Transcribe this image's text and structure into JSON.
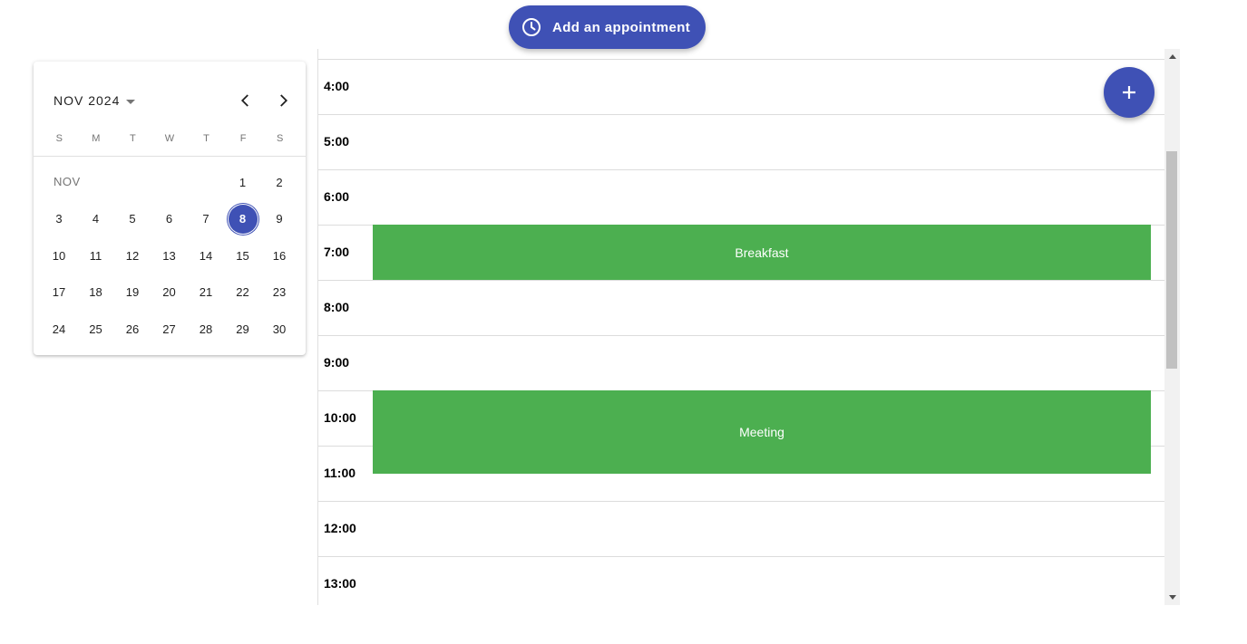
{
  "header": {
    "add_button_label": "Add an appointment",
    "add_button_icon": "clock-icon",
    "accent_color": "#3f51b5"
  },
  "datepicker": {
    "month_year": "NOV 2024",
    "month_short": "NOV",
    "weekdays": [
      "S",
      "M",
      "T",
      "W",
      "T",
      "F",
      "S"
    ],
    "days": [
      "1",
      "2",
      "3",
      "4",
      "5",
      "6",
      "7",
      "8",
      "9",
      "10",
      "11",
      "12",
      "13",
      "14",
      "15",
      "16",
      "17",
      "18",
      "19",
      "20",
      "21",
      "22",
      "23",
      "24",
      "25",
      "26",
      "27",
      "28",
      "29",
      "30"
    ],
    "first_weekday": 5,
    "selected_day": "8"
  },
  "schedule": {
    "hours": [
      "4:00",
      "5:00",
      "6:00",
      "7:00",
      "8:00",
      "9:00",
      "10:00",
      "11:00",
      "12:00",
      "13:00"
    ],
    "appointments": [
      {
        "title": "Breakfast",
        "start": "7:00",
        "end": "8:00",
        "color": "#4caf50"
      },
      {
        "title": "Meeting",
        "start": "10:00",
        "end": "11:30",
        "color": "#4caf50"
      }
    ],
    "fab_icon": "plus-icon"
  }
}
